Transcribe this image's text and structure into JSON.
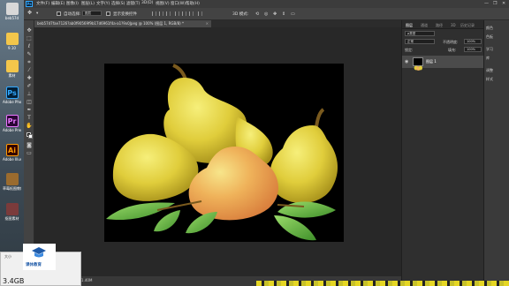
{
  "desktop": {
    "items": [
      {
        "label": "beb57d",
        "icon": "file-icon"
      },
      {
        "label": "9.10",
        "icon": "folder-icon"
      },
      {
        "label": "素材",
        "icon": "folder-icon"
      },
      {
        "label": "Adobe Photosh...",
        "icon": "photoshop-app-icon",
        "glyph": "Ps"
      },
      {
        "label": "Adobe Premiere P...",
        "icon": "premiere-app-icon",
        "glyph": "Pr"
      },
      {
        "label": "Adobe Illustrat...",
        "icon": "illustrator-app-icon",
        "glyph": "Ai"
      },
      {
        "label": "草莓抠图教程",
        "icon": "file-icon"
      },
      {
        "label": "抠图素材",
        "icon": "file-icon"
      }
    ]
  },
  "app": {
    "logo": "Ps",
    "menus": [
      "文件(F)",
      "编辑(E)",
      "图像(I)",
      "图层(L)",
      "文字(Y)",
      "选择(S)",
      "滤镜(T)",
      "3D(D)",
      "视图(V)",
      "窗口(W)",
      "帮助(H)"
    ],
    "window_controls": [
      "—",
      "❐",
      "✕"
    ]
  },
  "options": {
    "auto_select_label": "自动选择:",
    "auto_select_value": "图层",
    "show_transform_label": "显示变换控件",
    "mode_label": "3D 模式:"
  },
  "document": {
    "tab_title": "beb57d7fae7126?ab0f90569f9b17d6961f4a-a1?9x0Jpeg @ 100% (图层 1, RGB/8) *",
    "zoom": "100%",
    "doc_info": "文档:1.40M/1.40M"
  },
  "panels": {
    "tabs": [
      "图层",
      "通道",
      "路径",
      "3D",
      "历史记录"
    ],
    "search_placeholder": "ρ类型",
    "blend_mode": "正常",
    "opacity_label": "不透明度:",
    "opacity_value": "100%",
    "lock_label": "锁定:",
    "fill_label": "填充:",
    "fill_value": "100%",
    "layer_name": "图层 1"
  },
  "collapsed_panels": [
    "颜色",
    "色板",
    "学习",
    "库",
    "调整",
    "样式"
  ],
  "overlay": {
    "logo_text": "课休教育",
    "info_title": "大小",
    "info_value": "3.4GB"
  },
  "colors": {
    "accent": "#31a8ff",
    "foreground": "#000000",
    "background": "#ffffff"
  }
}
